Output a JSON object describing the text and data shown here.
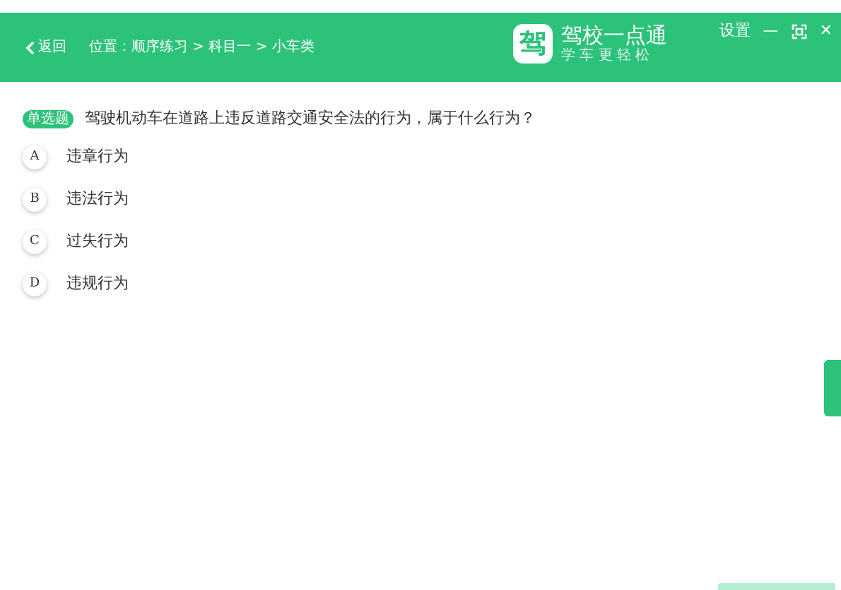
{
  "header": {
    "back": "返回",
    "location": "位置：顺序练习 > 科目一 > 小车类",
    "logo_mark": "驾",
    "logo_name": "驾校一点通",
    "logo_slogan": "学 车 更 轻 松",
    "settings": "设置",
    "minimize": "—",
    "close": "✕"
  },
  "question": {
    "tag": "单选题",
    "text": "驾驶机动车在道路上违反道路交通安全法的行为，属于什么行为？",
    "options": [
      {
        "letter": "A",
        "text": "违章行为",
        "selected": false
      },
      {
        "letter": "B",
        "text": "违法行为",
        "selected": false
      },
      {
        "letter": "C",
        "text": "过失行为",
        "selected": false
      },
      {
        "letter": "D",
        "text": "违规行为",
        "selected": false
      }
    ]
  }
}
